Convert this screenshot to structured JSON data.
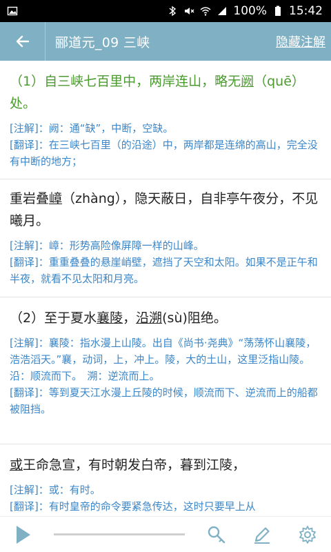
{
  "status_bar": {
    "battery_percent": "100%",
    "time": "15:42",
    "icons": [
      "image-icon",
      "bluetooth-icon",
      "mute-icon",
      "wifi-icon",
      "signal-icon",
      "battery-icon"
    ]
  },
  "app_bar": {
    "title": "郦道元_09 三峡",
    "action_label": "隐藏注解",
    "color": "#7fb0c4"
  },
  "sections": [
    {
      "original": "（1）自三峡七百里中，两岸连山，略无阙（quē）处。",
      "original_parts": [
        "（1）自三峡七百里中，两岸连山，略无",
        "阙",
        "（quē）处。"
      ],
      "note": "[注解]：阙：通“缺”，中断，空缺。",
      "translation": "[翻译]：在三峡七百里（的沿途）中，两岸都是连绵的高山，完全没有中断的地方；"
    },
    {
      "original": "重岩叠嶂（zhàng），隐天蔽日，自非亭午夜分，不见曦月。",
      "original_parts": [
        "重岩叠",
        "嶂",
        "（zhàng），隐天蔽日，自非亭午夜分，不见曦月。"
      ],
      "note": "[注解]：嶂：形势高险像屏障一样的山峰。",
      "translation": "[翻译]：重重叠叠的悬崖峭壁，遮挡了天空和太阳。如果不是正午和半夜，就看不见太阳和月亮。"
    },
    {
      "original": "（2）至于夏水襄陵，沿溯(sù)阻绝。",
      "original_parts": [
        "（2）至于夏水",
        "襄陵",
        "，",
        "沿溯",
        "(sù)阻绝。"
      ],
      "note": "[注解]：襄陵：指水漫上山陵。出自《尚书·尧典》“荡荡怀山襄陵，浩浩滔天。”襄，动词，上，冲上。陵，大的土山，这里泛指山陵。　沿：顺流而下。　溯：逆流而上。",
      "translation": "[翻译]：等到夏天江水漫上丘陵的时候，顺流而下、逆流而上的船都被阻挡。"
    },
    {
      "original": "或王命急宣，有时朝发白帝，暮到江陵，",
      "original_parts": [
        "或",
        "王命急宣，有时朝发白帝，暮到江陵，"
      ],
      "note": "[注解]：或：有时。",
      "translation": "[翻译]：有时皇帝的命令要紧急传达，这时只要早上从"
    }
  ],
  "bottom_bar": {
    "progress": 0,
    "icons": [
      "play-icon",
      "search-icon",
      "edit-icon",
      "settings-icon"
    ]
  }
}
